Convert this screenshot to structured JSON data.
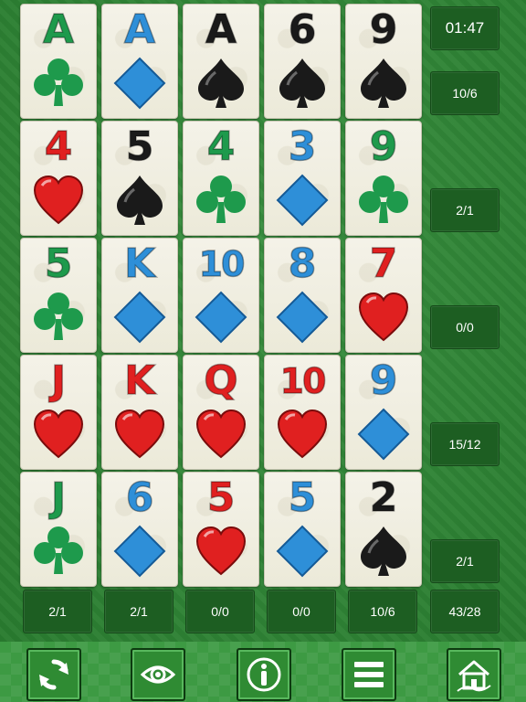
{
  "colors": {
    "red": "#e02020",
    "blue": "#2e8fd8",
    "green": "#1e9a4c",
    "black": "#1a1a1a",
    "panel": "#1d5e22"
  },
  "timer": "01:47",
  "grid": [
    [
      {
        "rank": "A",
        "suit": "clubs"
      },
      {
        "rank": "A",
        "suit": "diamonds"
      },
      {
        "rank": "A",
        "suit": "spades"
      },
      {
        "rank": "6",
        "suit": "spades"
      },
      {
        "rank": "9",
        "suit": "spades"
      }
    ],
    [
      {
        "rank": "4",
        "suit": "hearts"
      },
      {
        "rank": "5",
        "suit": "spades"
      },
      {
        "rank": "4",
        "suit": "clubs"
      },
      {
        "rank": "3",
        "suit": "diamonds"
      },
      {
        "rank": "9",
        "suit": "clubs"
      }
    ],
    [
      {
        "rank": "5",
        "suit": "clubs"
      },
      {
        "rank": "K",
        "suit": "diamonds"
      },
      {
        "rank": "10",
        "suit": "diamonds"
      },
      {
        "rank": "8",
        "suit": "diamonds"
      },
      {
        "rank": "7",
        "suit": "hearts"
      }
    ],
    [
      {
        "rank": "J",
        "suit": "hearts"
      },
      {
        "rank": "K",
        "suit": "hearts"
      },
      {
        "rank": "Q",
        "suit": "hearts"
      },
      {
        "rank": "10",
        "suit": "hearts"
      },
      {
        "rank": "9",
        "suit": "diamonds"
      }
    ],
    [
      {
        "rank": "J",
        "suit": "clubs"
      },
      {
        "rank": "6",
        "suit": "diamonds"
      },
      {
        "rank": "5",
        "suit": "hearts"
      },
      {
        "rank": "5",
        "suit": "diamonds"
      },
      {
        "rank": "2",
        "suit": "spades"
      }
    ]
  ],
  "row_scores": [
    "10/6",
    "2/1",
    "0/0",
    "15/12",
    "2/1"
  ],
  "column_scores": [
    "2/1",
    "2/1",
    "0/0",
    "0/0",
    "10/6"
  ],
  "total_score": "43/28",
  "toolbar": [
    {
      "name": "restart-button",
      "icon": "refresh-icon"
    },
    {
      "name": "hint-button",
      "icon": "eye-icon"
    },
    {
      "name": "info-button",
      "icon": "info-icon"
    },
    {
      "name": "menu-button",
      "icon": "menu-icon"
    },
    {
      "name": "home-button",
      "icon": "home-icon"
    }
  ]
}
